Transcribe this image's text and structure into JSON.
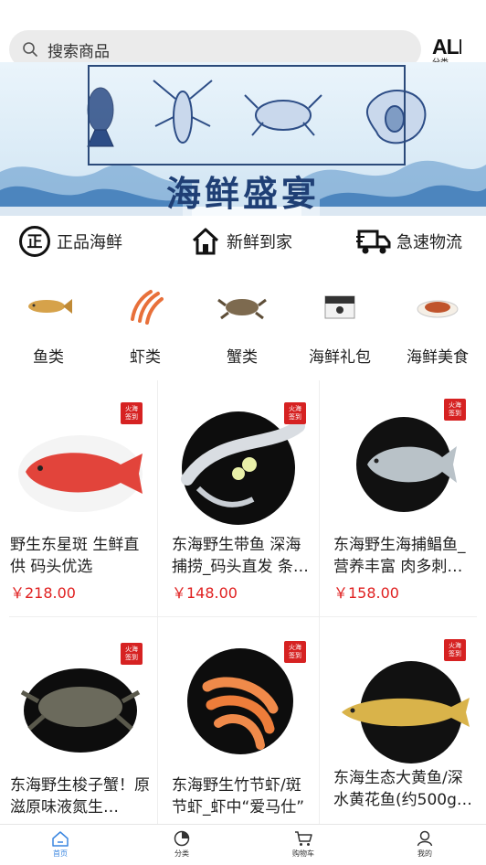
{
  "search": {
    "placeholder": "搜索商品",
    "icon": "search-icon"
  },
  "all_button": {
    "label": "ALL",
    "sub": "分类"
  },
  "banner": {
    "title": "海鲜盛宴"
  },
  "features": [
    {
      "icon": "zheng-icon",
      "label": "正品海鲜"
    },
    {
      "icon": "home-icon",
      "label": "新鲜到家"
    },
    {
      "icon": "truck-icon",
      "label": "急速物流"
    }
  ],
  "categories": [
    {
      "label": "鱼类"
    },
    {
      "label": "虾类"
    },
    {
      "label": "蟹类"
    },
    {
      "label": "海鲜礼包"
    },
    {
      "label": "海鲜美食"
    }
  ],
  "badge_text": "火海\n签到",
  "products": [
    {
      "title": "野生东星斑 生鲜直供 码头优选",
      "price": "￥218.00"
    },
    {
      "title": "东海野生带鱼 深海捕捞_码头直发 条…",
      "price": "￥148.00"
    },
    {
      "title": "东海野生海捕鲳鱼_营养丰富 肉多刺…",
      "price": "￥158.00"
    },
    {
      "title": "东海野生梭子蟹！原滋原味液氮生…",
      "price": ""
    },
    {
      "title": "东海野生竹节虾/斑节虾_虾中“爱马仕”",
      "price": ""
    },
    {
      "title": "东海生态大黄鱼/深水黄花鱼(约500g…",
      "price": ""
    }
  ],
  "tabs": [
    {
      "label": "首页",
      "icon": "home-tab-icon",
      "active": true
    },
    {
      "label": "分类",
      "icon": "pie-tab-icon"
    },
    {
      "label": "购物车",
      "icon": "cart-tab-icon"
    },
    {
      "label": "我的",
      "icon": "user-tab-icon"
    }
  ],
  "colors": {
    "price": "#e02020",
    "active_tab": "#3a86e0",
    "badge": "#d62222",
    "banner_text": "#1f3f75"
  }
}
